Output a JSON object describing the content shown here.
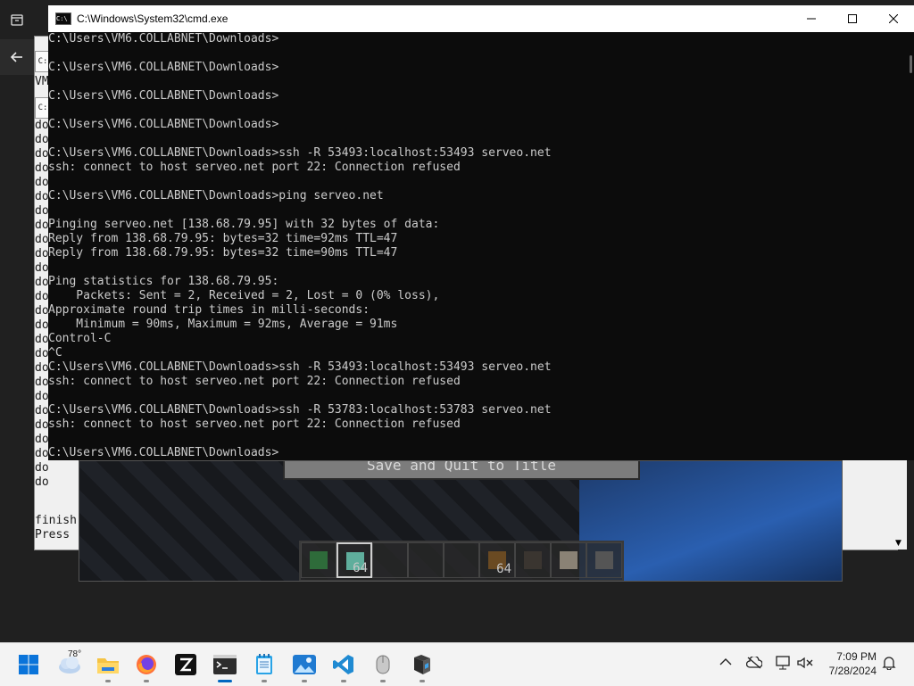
{
  "window": {
    "title": "C:\\Windows\\System32\\cmd.exe",
    "app_icon": "C:\\"
  },
  "console_lines": [
    "C:\\Users\\VM6.COLLABNET\\Downloads>",
    "",
    "C:\\Users\\VM6.COLLABNET\\Downloads>",
    "",
    "C:\\Users\\VM6.COLLABNET\\Downloads>",
    "",
    "C:\\Users\\VM6.COLLABNET\\Downloads>",
    "",
    "C:\\Users\\VM6.COLLABNET\\Downloads>ssh -R 53493:localhost:53493 serveo.net",
    "ssh: connect to host serveo.net port 22: Connection refused",
    "",
    "C:\\Users\\VM6.COLLABNET\\Downloads>ping serveo.net",
    "",
    "Pinging serveo.net [138.68.79.95] with 32 bytes of data:",
    "Reply from 138.68.79.95: bytes=32 time=92ms TTL=47",
    "Reply from 138.68.79.95: bytes=32 time=90ms TTL=47",
    "",
    "Ping statistics for 138.68.79.95:",
    "    Packets: Sent = 2, Received = 2, Lost = 0 (0% loss),",
    "Approximate round trip times in milli-seconds:",
    "    Minimum = 90ms, Maximum = 92ms, Average = 91ms",
    "Control-C",
    "^C",
    "C:\\Users\\VM6.COLLABNET\\Downloads>ssh -R 53493:localhost:53493 serveo.net",
    "ssh: connect to host serveo.net port 22: Connection refused",
    "",
    "C:\\Users\\VM6.COLLABNET\\Downloads>ssh -R 53783:localhost:53783 serveo.net",
    "ssh: connect to host serveo.net port 22: Connection refused",
    "",
    "C:\\Users\\VM6.COLLABNET\\Downloads>"
  ],
  "background_console": {
    "first_line": "VM",
    "tab_label": "C:",
    "left_fragments": [
      "do",
      "do",
      "do",
      "do",
      "do",
      "do",
      "do",
      "do",
      "do",
      "do",
      "do",
      "do",
      "do",
      "do",
      "do",
      "do",
      "do",
      "do",
      "do",
      "do",
      "do",
      "do",
      "do",
      "do",
      "do",
      "do"
    ],
    "footer_lines": [
      "finish",
      "Press"
    ]
  },
  "game": {
    "button_label": "Save and Quit to Title",
    "hotbar_counts": [
      "",
      "64",
      "",
      "",
      "",
      "64",
      "",
      "",
      ""
    ]
  },
  "taskbar": {
    "weather_temp": "78°",
    "clock_time": "7:09 PM",
    "clock_date": "7/28/2024",
    "apps": [
      "start-icon",
      "weather-icon",
      "file-explorer-icon",
      "firefox-icon",
      "zed-icon",
      "terminal-icon",
      "notepad-icon",
      "photos-icon",
      "vscode-icon",
      "mouse-app-icon",
      "minecraft-icon"
    ]
  },
  "colors": {
    "console_bg": "#0c0c0c",
    "console_text": "#cccccc",
    "taskbar_bg": "#f3f3f3",
    "accent": "#0067c0"
  }
}
